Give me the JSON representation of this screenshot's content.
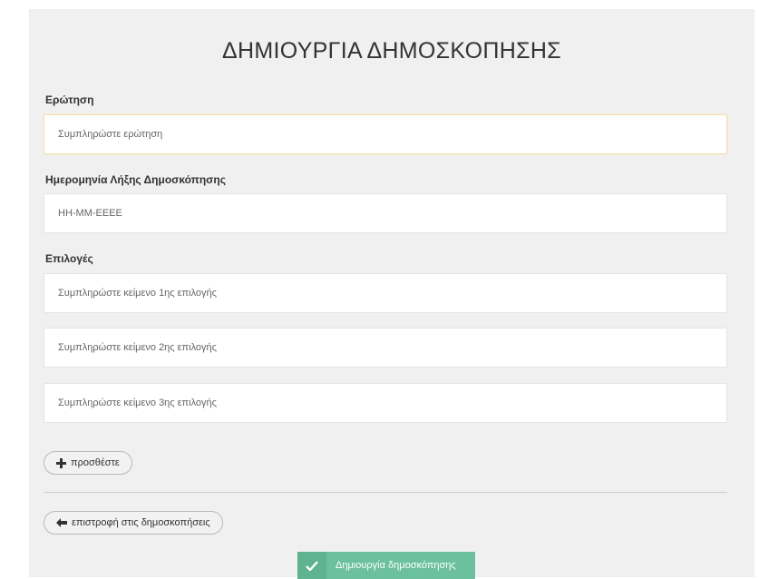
{
  "page": {
    "title": "ΔΗΜΙΟΥΡΓΙΑ ΔΗΜΟΣΚΟΠΗΣΗΣ"
  },
  "question": {
    "label": "Ερώτηση",
    "placeholder": "Συμπληρώστε ερώτηση",
    "value": ""
  },
  "expiry": {
    "label": "Ημερομηνία Λήξης Δημοσκόπησης",
    "placeholder": "ΗΗ-ΜΜ-ΕΕΕΕ",
    "value": ""
  },
  "options": {
    "label": "Επιλογές",
    "items": [
      {
        "placeholder": "Συμπληρώστε κείμενο 1ης επιλογής",
        "value": ""
      },
      {
        "placeholder": "Συμπληρώστε κείμενο 2ης επιλογής",
        "value": ""
      },
      {
        "placeholder": "Συμπληρώστε κείμενο 3ης επιλογής",
        "value": ""
      }
    ],
    "add_label": "προσθέστε",
    "add_icon": "plus-icon"
  },
  "navigation": {
    "back_label": "επιστροφή στις δημοσκοπήσεις",
    "back_icon": "arrow-left-icon"
  },
  "submit": {
    "label": "Δημιουργία δημοσκόπησης",
    "icon": "check-icon"
  },
  "colors": {
    "panel_background": "#f0f0f1",
    "submit_button": "#6cc09d",
    "focus_border": "#f3dfa6"
  }
}
